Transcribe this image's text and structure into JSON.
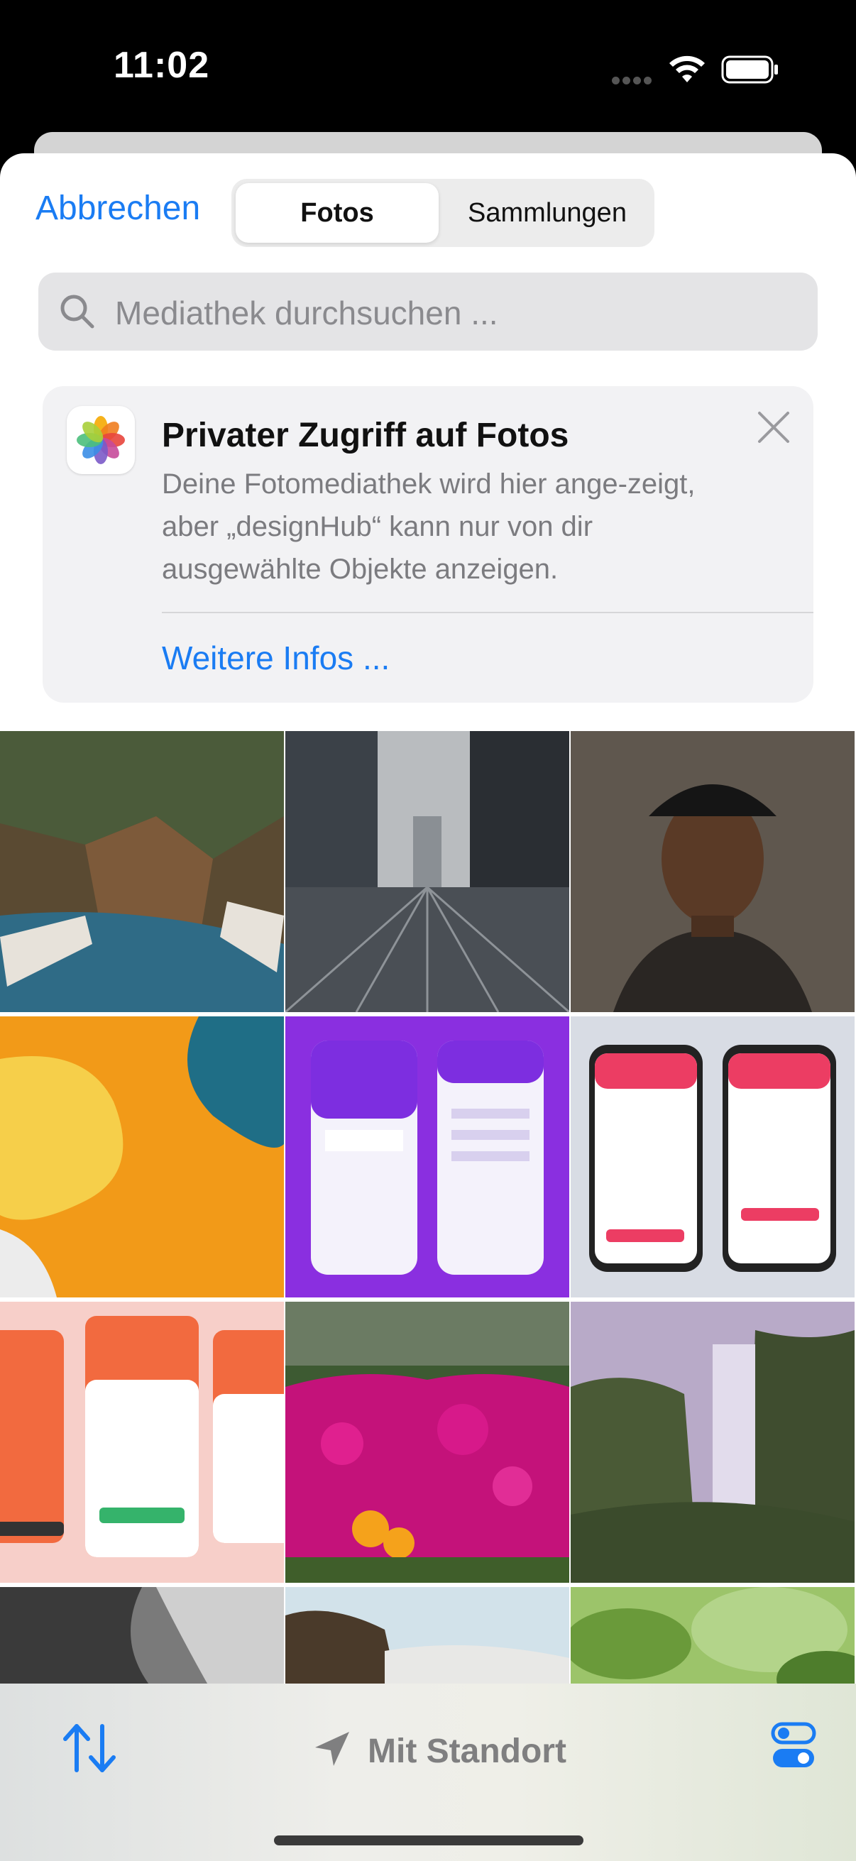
{
  "status_bar": {
    "time": "11:02"
  },
  "sheet": {
    "cancel_label": "Abbrechen",
    "segments": [
      "Fotos",
      "Sammlungen"
    ],
    "search_placeholder": "Mediathek durchsuchen ..."
  },
  "notice": {
    "title": "Privater Zugriff auf Fotos",
    "body": "Deine Fotomediathek wird hier ange-zeigt, aber „designHub“ kann nur von dir ausgewählte Objekte anzeigen.",
    "link": "Weitere Infos ..."
  },
  "photos": [
    "feet-over-cliff",
    "rainy-street-bridge",
    "portrait-man-cap",
    "orange-waves",
    "purple-app-mockup",
    "order-checkout-mockup",
    "orange-login-mockup",
    "pink-flowers",
    "waterfall",
    "rock-water",
    "coast-cliff",
    "green-leaves"
  ],
  "bottom_bar": {
    "location_label": "Mit Standort"
  },
  "colors": {
    "accent": "#1a7cf3",
    "segment_bg": "#ececec",
    "card_bg": "#f2f2f4"
  }
}
